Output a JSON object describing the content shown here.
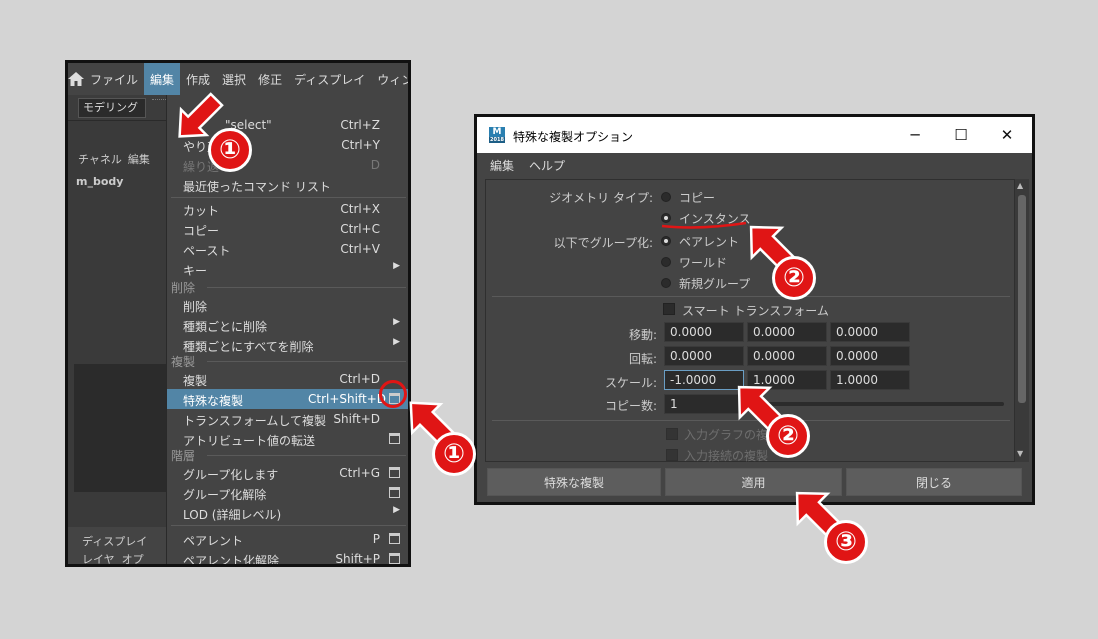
{
  "menubar": {
    "items": [
      "ファイル",
      "編集",
      "作成",
      "選択",
      "修正",
      "ディスプレイ",
      "ウィンド"
    ],
    "active_index": 1
  },
  "toolbar": {
    "mode": "モデリング"
  },
  "side_panel": {
    "tab_channels": "チャネル",
    "tab_edit": "編集",
    "object_name": "m_body",
    "bottom_tab_display": "ディスプレイ",
    "bottom_tab_layer": "レイヤ",
    "bottom_tab_option": "オプ"
  },
  "edit_menu": {
    "undo_label": "\"select\"",
    "undo_shortcut": "Ctrl+Z",
    "redo_label": "やり直",
    "redo_shortcut": "Ctrl+Y",
    "repeat_label": "繰り返",
    "repeat_shortcut": "D",
    "recent_label": "最近使ったコマンド リスト",
    "cut_label": "カット",
    "cut_shortcut": "Ctrl+X",
    "copy_label": "コピー",
    "copy_shortcut": "Ctrl+C",
    "paste_label": "ペースト",
    "paste_shortcut": "Ctrl+V",
    "keys_label": "キー",
    "section_delete": "削除",
    "delete_label": "削除",
    "delete_by_type_label": "種類ごとに削除",
    "delete_all_by_type_label": "種類ごとにすべてを削除",
    "section_duplicate": "複製",
    "duplicate_label": "複製",
    "duplicate_shortcut": "Ctrl+D",
    "duplicate_special_label": "特殊な複製",
    "duplicate_special_shortcut": "Ctrl+Shift+D",
    "duplicate_transform_label": "トランスフォームして複製",
    "duplicate_transform_shortcut": "Shift+D",
    "transfer_attr_label": "アトリビュート値の転送",
    "section_hierarchy": "階層",
    "group_label": "グループ化します",
    "group_shortcut": "Ctrl+G",
    "ungroup_label": "グループ化解除",
    "lod_label": "LOD (詳細レベル)",
    "parent_label": "ペアレント",
    "parent_shortcut": "P",
    "unparent_label": "ペアレント化解除",
    "unparent_shortcut": "Shift+P"
  },
  "dialog": {
    "app_icon_letter": "M",
    "app_icon_sub": "2018",
    "title": "特殊な複製オプション",
    "menu_edit": "編集",
    "menu_help": "ヘルプ",
    "geometry_type_label": "ジオメトリ タイプ:",
    "geometry_copy": "コピー",
    "geometry_instance": "インスタンス",
    "group_under_label": "以下でグループ化:",
    "group_parent": "ペアレント",
    "group_world": "ワールド",
    "group_new": "新規グループ",
    "smart_transform": "スマート トランスフォーム",
    "translate_label": "移動:",
    "translate": [
      "0.0000",
      "0.0000",
      "0.0000"
    ],
    "rotate_label": "回転:",
    "rotate": [
      "0.0000",
      "0.0000",
      "0.0000"
    ],
    "scale_label": "スケール:",
    "scale": [
      "-1.0000",
      "1.0000",
      "1.0000"
    ],
    "copies_label": "コピー数:",
    "copies": "1",
    "dup_input_graph": "入力グラフの複製",
    "dup_input_connections": "入力接続の複製",
    "btn_duplicate_special": "特殊な複製",
    "btn_apply": "適用",
    "btn_close": "閉じる",
    "geometry_selected": "インスタンス",
    "group_selected": "ペアレント"
  },
  "annotations": {
    "step1": "①",
    "step2": "②",
    "step3": "③",
    "accent_color": "#e01515"
  }
}
